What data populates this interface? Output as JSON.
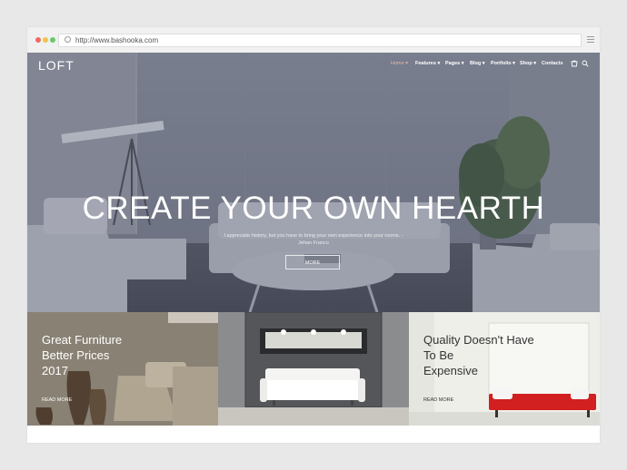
{
  "browser": {
    "url": "http://www.bashooka.com",
    "dots": [
      "#ee6c61",
      "#f2c24f",
      "#69c96a"
    ],
    "lock_icon": "globe-icon",
    "menu_icon": "hamburger-icon"
  },
  "site": {
    "logo": "LOFT",
    "accent": "#e0b8a9"
  },
  "nav": {
    "items": [
      {
        "label": "Home ▾"
      },
      {
        "label": "Features ▾"
      },
      {
        "label": "Pages ▾"
      },
      {
        "label": "Blog ▾"
      },
      {
        "label": "Portfolio ▾"
      },
      {
        "label": "Shop ▾"
      },
      {
        "label": "Contacts"
      }
    ],
    "cart_icon": "cart-icon",
    "search_icon": "search-icon"
  },
  "hero": {
    "title": "CREATE YOUR OWN HEARTH",
    "subtitle_line1": "I appreciate history, but you have to bring your own experience into your rooms. -",
    "subtitle_line2": "Jehan Franco",
    "button": "MORE"
  },
  "tiles": [
    {
      "line1": "Great Furniture",
      "line2": "Better Prices",
      "line3": "2017",
      "link": "READ MORE"
    },
    {},
    {
      "line1": "Quality Doesn't Have",
      "line2": "To Be",
      "line3": "Expensive",
      "link": "READ MORE"
    }
  ]
}
